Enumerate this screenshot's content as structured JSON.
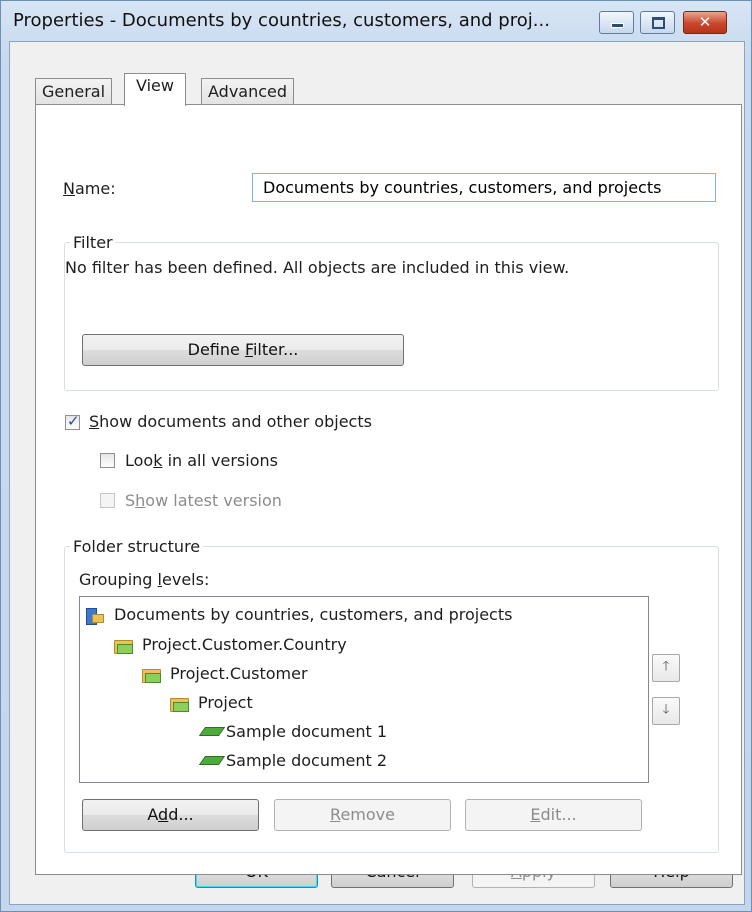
{
  "window": {
    "title": "Properties - Documents by countries, customers, and proj...",
    "controls": {
      "minimize_icon": "minimize-icon",
      "maximize_icon": "maximize-icon",
      "close_icon": "close-icon",
      "close_glyph": "✕"
    }
  },
  "tabs": [
    {
      "label": "General",
      "selected": false
    },
    {
      "label": "View",
      "selected": true
    },
    {
      "label": "Advanced",
      "selected": false
    }
  ],
  "name_field": {
    "label_mnemonic": "N",
    "label_rest": "ame:",
    "value": "Documents by countries, customers, and projects"
  },
  "filter": {
    "legend": "Filter",
    "description": "No filter has been defined. All objects are included in this view.",
    "define_button": {
      "before": "Define ",
      "mnemonic": "F",
      "after": "ilter..."
    }
  },
  "options": {
    "show_documents": {
      "mnemonic": "S",
      "rest": "how documents and other objects",
      "checked": true,
      "enabled": true
    },
    "look_all_versions": {
      "before": "Loo",
      "mnemonic": "k",
      "after": " in all versions",
      "checked": false,
      "enabled": true
    },
    "show_latest": {
      "before": "S",
      "mnemonic": "h",
      "after": "ow latest version",
      "checked": false,
      "enabled": false
    }
  },
  "folder_structure": {
    "legend": "Folder structure",
    "grouping_label": {
      "before": "Grouping ",
      "mnemonic": "l",
      "after": "evels:"
    },
    "tree": [
      {
        "label": "Documents by countries, customers, and projects",
        "icon": "view-icon",
        "level": 0
      },
      {
        "label": "Project.Customer.Country",
        "icon": "folder-icon",
        "level": 1
      },
      {
        "label": "Project.Customer",
        "icon": "folder-icon",
        "level": 2
      },
      {
        "label": "Project",
        "icon": "folder-icon",
        "level": 3
      },
      {
        "label": "Sample document 1",
        "icon": "document-icon",
        "level": 4
      },
      {
        "label": "Sample document 2",
        "icon": "document-icon",
        "level": 4
      }
    ],
    "move_up_glyph": "🡑",
    "move_down_glyph": "🡓",
    "buttons": {
      "add": {
        "before": "A",
        "mnemonic": "d",
        "after": "d...",
        "enabled": true
      },
      "remove": {
        "before": "",
        "mnemonic": "R",
        "after": "emove",
        "enabled": false
      },
      "edit": {
        "before": "",
        "mnemonic": "E",
        "after": "dit...",
        "enabled": false
      }
    }
  },
  "dialog_buttons": {
    "ok": {
      "label": "OK",
      "enabled": true
    },
    "cancel": {
      "label": "Cancel",
      "enabled": true
    },
    "apply": {
      "mnemonic": "A",
      "rest": "pply",
      "enabled": false
    },
    "help": {
      "label": "Help",
      "enabled": true
    }
  }
}
